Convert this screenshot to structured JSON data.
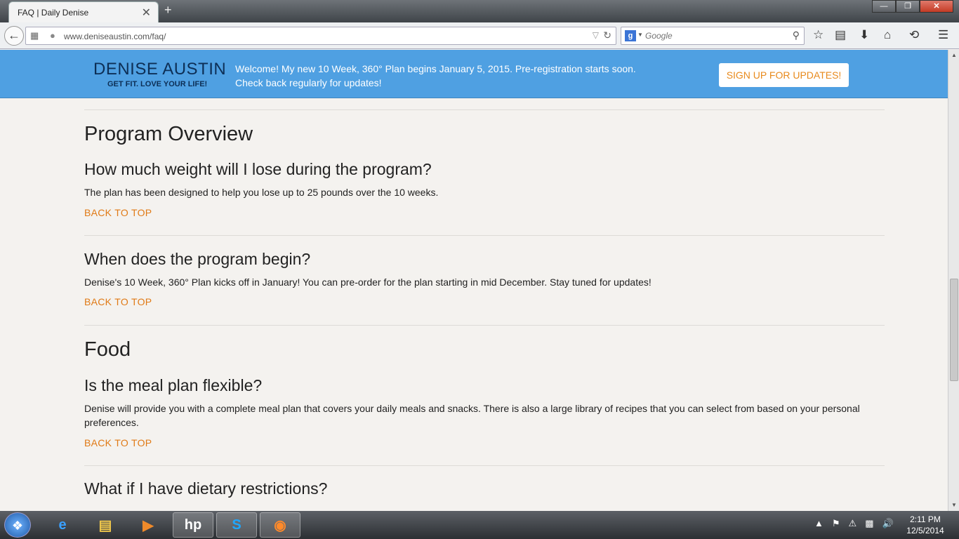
{
  "browser": {
    "tab_title": "FAQ | Daily Denise",
    "tab_close": "✕",
    "new_tab": "+",
    "url": "www.deniseaustin.com/faq/",
    "search_placeholder": "Google",
    "window_controls": [
      "—",
      "❐",
      "✕"
    ]
  },
  "header": {
    "logo_name": "DENISE AUSTIN",
    "logo_tagline": "GET FIT. LOVE YOUR LIFE!",
    "welcome_line1": "Welcome! My new 10 Week, 360° Plan begins January 5, 2015. Pre-registration starts soon.",
    "welcome_line2": "Check back regularly for updates!",
    "signup_label": "SIGN UP FOR UPDATES!"
  },
  "sections": [
    {
      "title": "Program Overview",
      "faqs": [
        {
          "question": "How much weight will I lose during the program?",
          "answer": "The plan has been designed to help you lose up to 25 pounds over the 10 weeks.",
          "back_label": "BACK TO TOP"
        },
        {
          "question": "When does the program begin?",
          "answer": "Denise's 10 Week, 360° Plan kicks off in January! You can pre-order for the plan starting in mid December. Stay tuned for updates!",
          "back_label": "BACK TO TOP"
        }
      ]
    },
    {
      "title": "Food",
      "faqs": [
        {
          "question": "Is the meal plan flexible?",
          "answer": "Denise will provide you with a complete meal plan that covers your daily meals and snacks. There is also a large library of recipes that you can select from based on your personal preferences.",
          "back_label": "BACK TO TOP"
        },
        {
          "question": "What if I have dietary restrictions?",
          "answer": "",
          "back_label": ""
        }
      ]
    }
  ],
  "taskbar": {
    "time": "2:11 PM",
    "date": "12/5/2014"
  },
  "colors": {
    "header_blue": "#4fa0e2",
    "logo_navy": "#0d2f56",
    "accent_orange": "#e07a16"
  }
}
